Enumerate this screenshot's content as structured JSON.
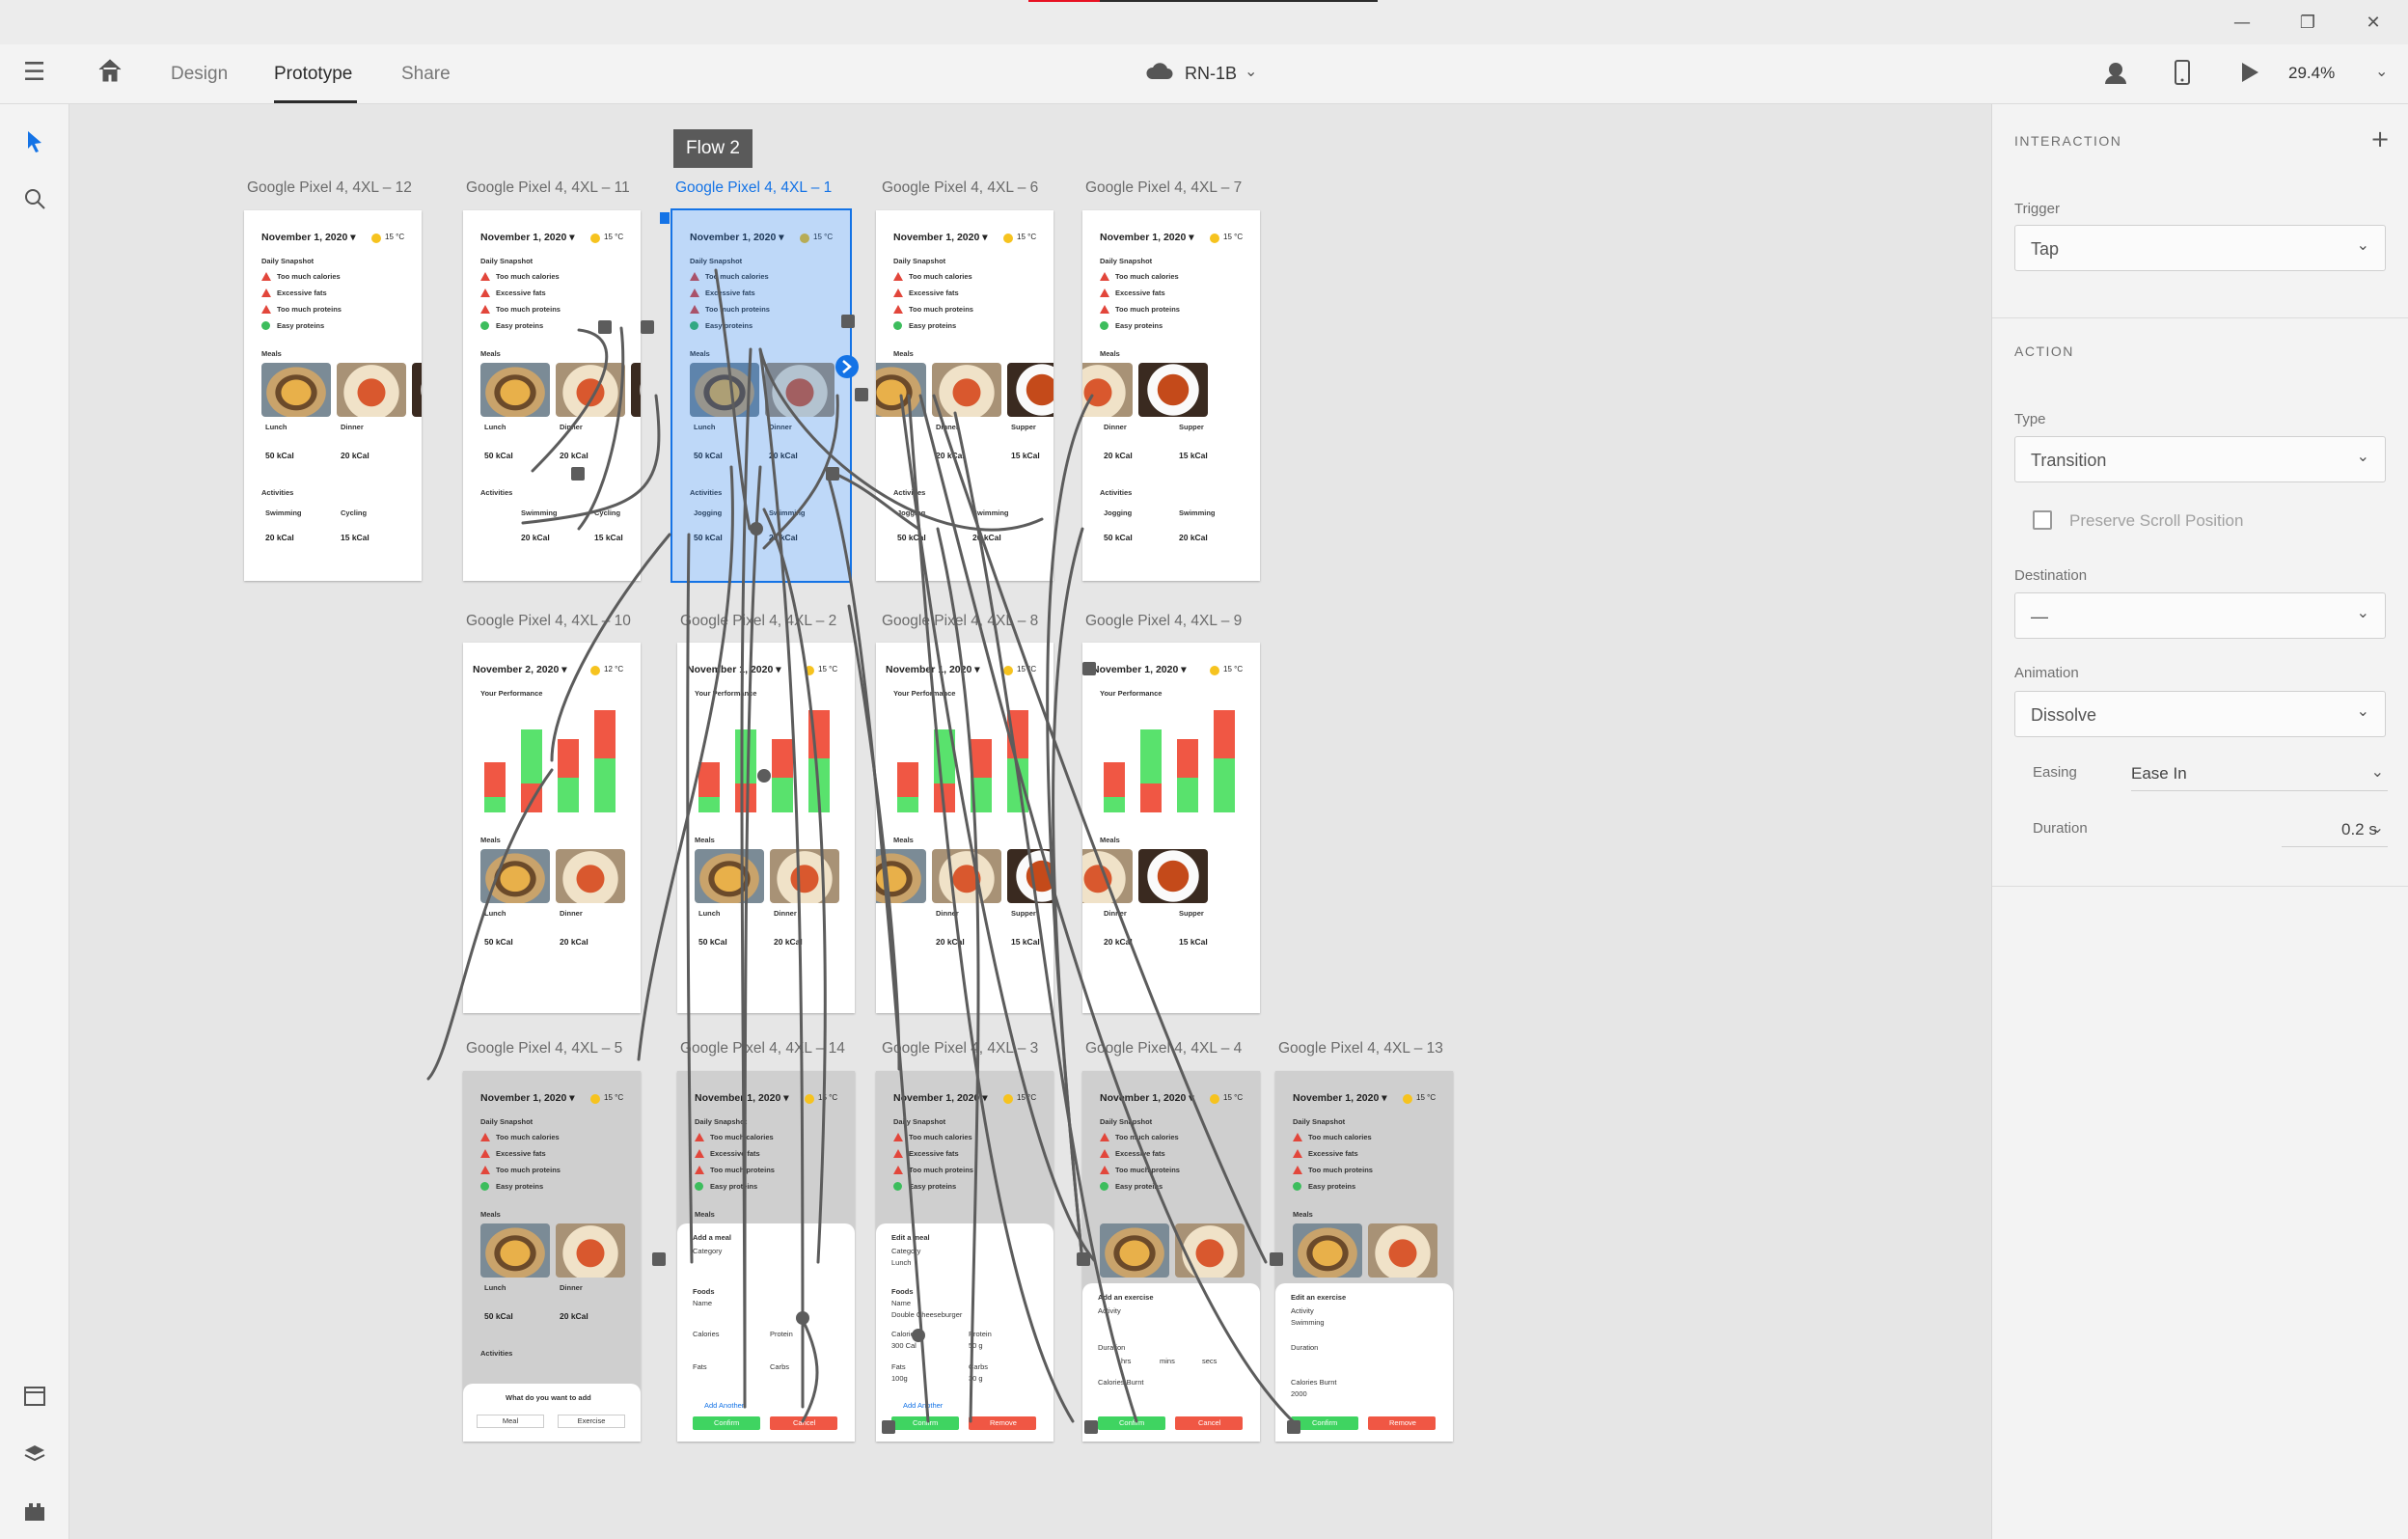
{
  "window": {
    "minimize": "—",
    "restore": "❐",
    "close": "✕"
  },
  "appbar": {
    "tabs": [
      "Design",
      "Prototype",
      "Share"
    ],
    "document": "RN-1B",
    "zoom": "29.4%"
  },
  "canvas": {
    "flow_tag": "Flow 2",
    "artboards": [
      {
        "label": "Google Pixel 4, 4XL – 12"
      },
      {
        "label": "Google Pixel 4, 4XL – 11"
      },
      {
        "label": "Google Pixel 4, 4XL – 1"
      },
      {
        "label": "Google Pixel 4, 4XL – 6"
      },
      {
        "label": "Google Pixel 4, 4XL – 7"
      },
      {
        "label": "Google Pixel 4, 4XL – 10"
      },
      {
        "label": "Google Pixel 4, 4XL – 2"
      },
      {
        "label": "Google Pixel 4, 4XL – 8"
      },
      {
        "label": "Google Pixel 4, 4XL – 9"
      },
      {
        "label": "Google Pixel 4, 4XL – 5"
      },
      {
        "label": "Google Pixel 4, 4XL – 14"
      },
      {
        "label": "Google Pixel 4, 4XL – 3"
      },
      {
        "label": "Google Pixel 4, 4XL – 4"
      },
      {
        "label": "Google Pixel 4, 4XL – 13"
      }
    ],
    "screen": {
      "date": "November 1, 2020 ▾",
      "date2": "November 2, 2020 ▾",
      "temp": "15 °C",
      "temp2": "12 °C",
      "snapshot": "Daily Snapshot",
      "alerts": [
        "Too much calories",
        "Excessive fats",
        "Too much proteins",
        "Easy proteins"
      ],
      "meals": "Meals",
      "lunch": "Lunch",
      "dinner": "Dinner",
      "supper": "Supper",
      "kcal_50": "50 kCal",
      "kcal_20": "20 kCal",
      "kcal_15": "15 kCal",
      "activities": "Activities",
      "swimming": "Swimming",
      "cycling": "Cycling",
      "jogging": "Jogging",
      "performance": "Your Performance",
      "add_prompt": "What do you want to add",
      "meal": "Meal",
      "exercise": "Exercise",
      "add_meal": "Add a meal",
      "edit_meal": "Edit a meal",
      "add_exercise": "Add an exercise",
      "edit_exercise": "Edit an exercise",
      "confirm": "Confirm",
      "cancel": "Cancel",
      "remove": "Remove",
      "category": "Category",
      "foods": "Foods",
      "name": "Name",
      "calories": "Calories",
      "protein": "Protein",
      "fats": "Fats",
      "carbs": "Carbs",
      "add_another": "Add Another",
      "lunch_val": "Lunch",
      "double_cheeseburger": "Double Cheeseburger",
      "v300": "300 Cal",
      "v50": "50 g",
      "v100": "100g",
      "v30": "30 g",
      "activity": "Activity",
      "duration_lbl": "Duration",
      "calories_burnt": "Calories Burnt",
      "swimming_val": "Swimming",
      "burnt_val": "2000",
      "hrs": "hrs",
      "mins": "mins",
      "secs": "secs"
    }
  },
  "panel": {
    "interaction_title": "INTERACTION",
    "trigger_label": "Trigger",
    "trigger_value": "Tap",
    "action_title": "ACTION",
    "type_label": "Type",
    "type_value": "Transition",
    "preserve_scroll": "Preserve Scroll Position",
    "destination_label": "Destination",
    "destination_value": "—",
    "animation_label": "Animation",
    "animation_value": "Dissolve",
    "easing_label": "Easing",
    "easing_value": "Ease In",
    "duration_label": "Duration",
    "duration_value": "0.2 s"
  },
  "colors": {
    "accent": "#1473e6",
    "warning": "#e2463b",
    "ok": "#3dbd5d",
    "confirm": "#3fd461",
    "cancel": "#f05744"
  }
}
